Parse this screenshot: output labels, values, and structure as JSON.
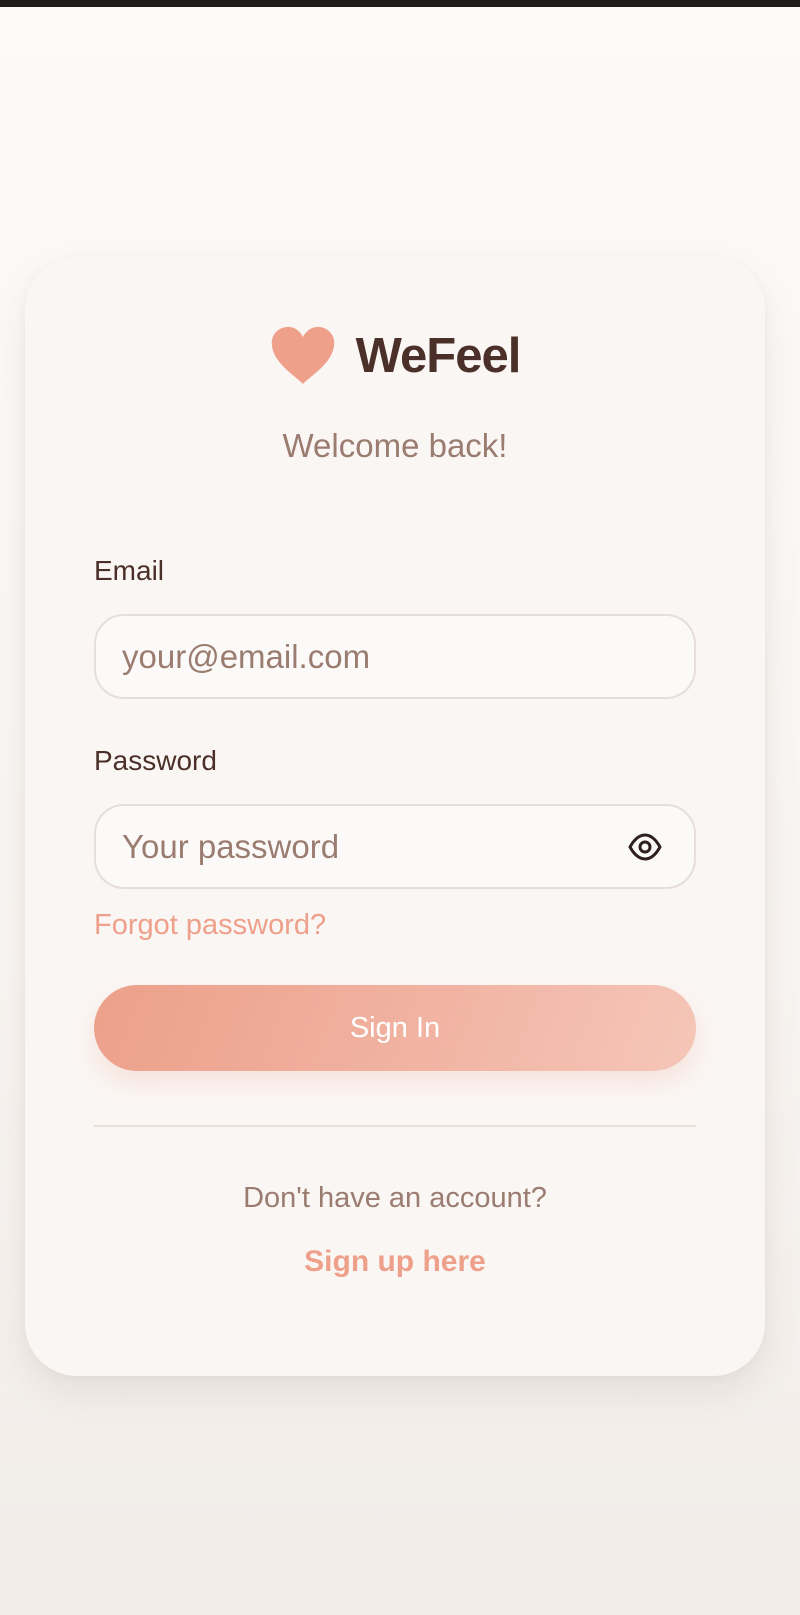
{
  "app": {
    "name": "WeFeel",
    "subtitle": "Welcome back!",
    "logo_icon": "heart-icon",
    "accent_color": "#eea08a",
    "text_color": "#4a3028",
    "muted_color": "#9a7c70"
  },
  "form": {
    "email": {
      "label": "Email",
      "placeholder": "your@email.com",
      "value": ""
    },
    "password": {
      "label": "Password",
      "placeholder": "Your password",
      "value": "",
      "toggle_icon": "eye-icon"
    },
    "forgot_label": "Forgot password?",
    "submit_label": "Sign In"
  },
  "footer": {
    "prompt": "Don't have an account?",
    "signup_label": "Sign up here"
  }
}
